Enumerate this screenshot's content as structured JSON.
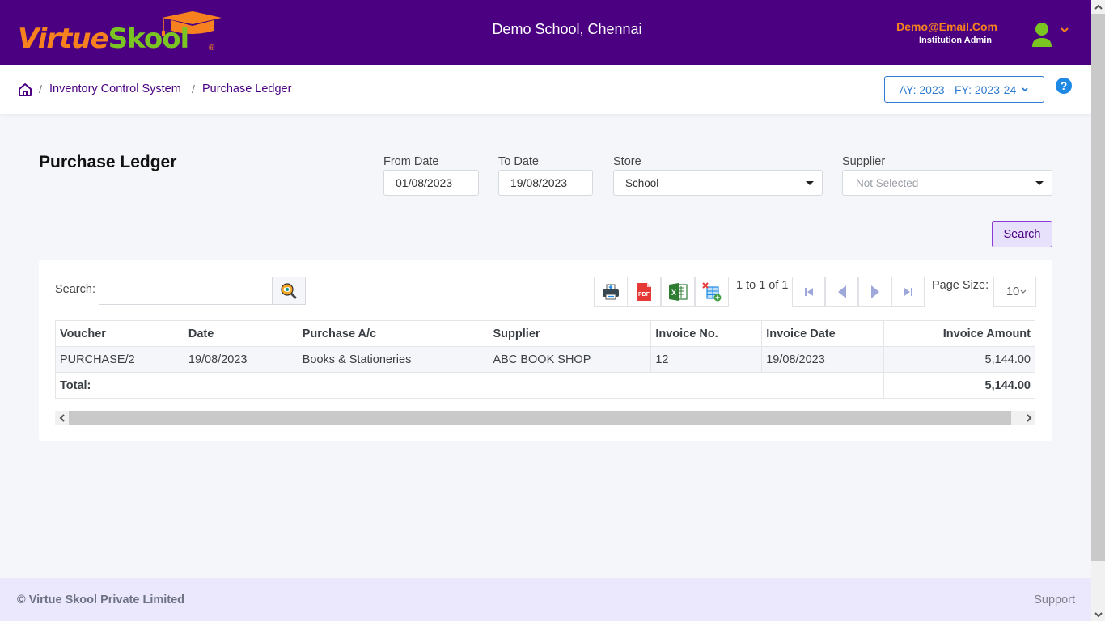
{
  "header": {
    "logo": {
      "part1": "Virtue",
      "part2": "Skool",
      "registered": "®",
      "icon": "graduation-cap-icon"
    },
    "school_name": "Demo School, Chennai",
    "user": {
      "email": "Demo@Email.Com",
      "role": "Institution Admin",
      "avatar_icon": "user-avatar-icon",
      "menu_icon": "chevron-down-icon"
    },
    "colors": {
      "brand_purple": "#4b0082",
      "brand_orange": "#f7811f",
      "brand_green": "#7ac522"
    }
  },
  "breadcrumb": {
    "home_icon": "home-icon",
    "items": [
      {
        "label": "Inventory Control System"
      },
      {
        "label": "Purchase Ledger"
      }
    ],
    "separator": "/"
  },
  "academic_year": {
    "label": "AY: 2023 - FY: 2023-24",
    "icon": "chevron-down-icon"
  },
  "help": {
    "label": "?"
  },
  "page": {
    "title": "Purchase Ledger",
    "filters": {
      "from_date": {
        "label": "From Date",
        "value": "01/08/2023"
      },
      "to_date": {
        "label": "To Date",
        "value": "19/08/2023"
      },
      "store": {
        "label": "Store",
        "value": "School"
      },
      "supplier": {
        "label": "Supplier",
        "placeholder": "Not Selected"
      }
    },
    "search_button": "Search"
  },
  "grid": {
    "search_label": "Search:",
    "search_value": "",
    "toolbar": [
      {
        "name": "print",
        "icon": "printer-icon"
      },
      {
        "name": "pdf",
        "icon": "pdf-icon",
        "text": "PDF"
      },
      {
        "name": "excel",
        "icon": "excel-icon",
        "text": "X"
      },
      {
        "name": "columns",
        "icon": "column-chooser-icon"
      }
    ],
    "pager": {
      "info": "1 to 1 of 1",
      "buttons": [
        "first-page",
        "previous-page",
        "next-page",
        "last-page"
      ],
      "page_size_label": "Page Size:",
      "page_size": "10"
    },
    "columns": [
      "Voucher",
      "Date",
      "Purchase A/c",
      "Supplier",
      "Invoice No.",
      "Invoice Date",
      "Invoice Amount"
    ],
    "rows": [
      [
        "PURCHASE/2",
        "19/08/2023",
        "Books & Stationeries",
        "ABC BOOK SHOP",
        "12",
        "19/08/2023",
        "5,144.00"
      ]
    ],
    "total": {
      "label": "Total:",
      "amount": "5,144.00"
    }
  },
  "footer": {
    "copyright": "© Virtue Skool Private Limited",
    "support": "Support"
  }
}
